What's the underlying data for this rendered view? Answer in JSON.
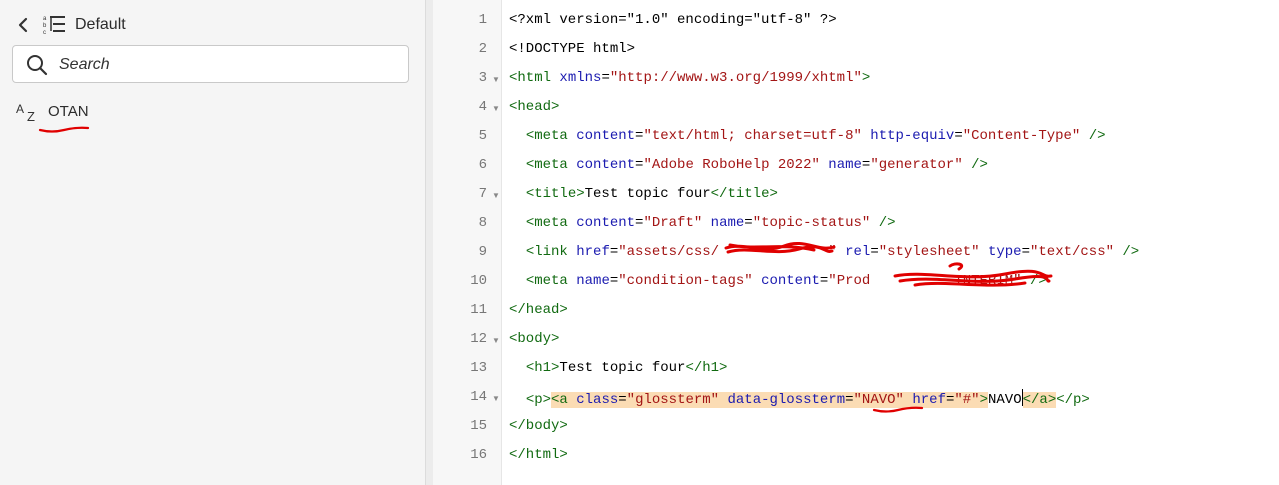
{
  "sidebar": {
    "back_icon": "chevron-left-icon",
    "sort_icon": "sort-list-icon",
    "title": "Default",
    "search": {
      "placeholder": "Search",
      "icon": "search-icon"
    },
    "terms": [
      {
        "icon": "sort-az-icon",
        "label": "OTAN"
      }
    ]
  },
  "editor": {
    "line_numbers": [
      "1",
      "2",
      "3",
      "4",
      "5",
      "6",
      "7",
      "8",
      "9",
      "10",
      "11",
      "12",
      "13",
      "14",
      "15",
      "16"
    ],
    "fold_lines": [
      "3",
      "4",
      "7",
      "12",
      "14"
    ],
    "lines": {
      "l1": "<?xml version=\"1.0\" encoding=\"utf-8\" ?>",
      "l2": "<!DOCTYPE html>",
      "l3": {
        "tag_open": "<html",
        "attr": "xmlns",
        "val": "\"http://www.w3.org/1999/xhtml\"",
        "close": ">"
      },
      "l4": "<head>",
      "l5": {
        "tag_open": "<meta",
        "attr1": "content",
        "val1": "\"text/html; charset=utf-8\"",
        "attr2": "http-equiv",
        "val2": "\"Content-Type\"",
        "close": "/>"
      },
      "l6": {
        "tag_open": "<meta",
        "attr1": "content",
        "val1": "\"Adobe RoboHelp 2022\"",
        "attr2": "name",
        "val2": "\"generator\"",
        "close": "/>"
      },
      "l7": {
        "open": "<title>",
        "text": "Test topic four",
        "close": "</title>"
      },
      "l8": {
        "tag_open": "<meta",
        "attr1": "content",
        "val1": "\"Draft\"",
        "attr2": "name",
        "val2": "\"topic-status\"",
        "close": "/>"
      },
      "l9": {
        "tag_open": "<link",
        "attr1": "href",
        "val1": "\"assets/css/",
        "val1_end": "\"",
        "attr2": "rel",
        "val2": "\"stylesheet\"",
        "attr3": "type",
        "val3": "\"text/css\"",
        "close": "/>"
      },
      "l10": {
        "tag_open": "<meta",
        "attr1": "name",
        "val1": "\"condition-tags\"",
        "attr2": "content",
        "val2": "\"Prod",
        "val2_end": "INTERIM\"",
        "close": "/>"
      },
      "l11": "</head>",
      "l12": "<body>",
      "l13": {
        "open": "<h1>",
        "text": "Test topic four",
        "close": "</h1>"
      },
      "l14": {
        "p_open": "<p>",
        "a_open": "<a",
        "attr1": "class",
        "val1": "\"glossterm\"",
        "attr2": "data-glossterm",
        "val2": "\"NAVO\"",
        "attr3": "href",
        "val3": "\"#\"",
        "gt": ">",
        "text": "NAVO",
        "a_close": "</a>",
        "p_close": "</p>"
      },
      "l15": "</body>",
      "l16": "</html>"
    }
  },
  "colors": {
    "tag": "#116a11",
    "attr": "#1b1bb0",
    "value": "#a31515",
    "highlight": "#fbdcb4",
    "annotation": "#e00000"
  }
}
